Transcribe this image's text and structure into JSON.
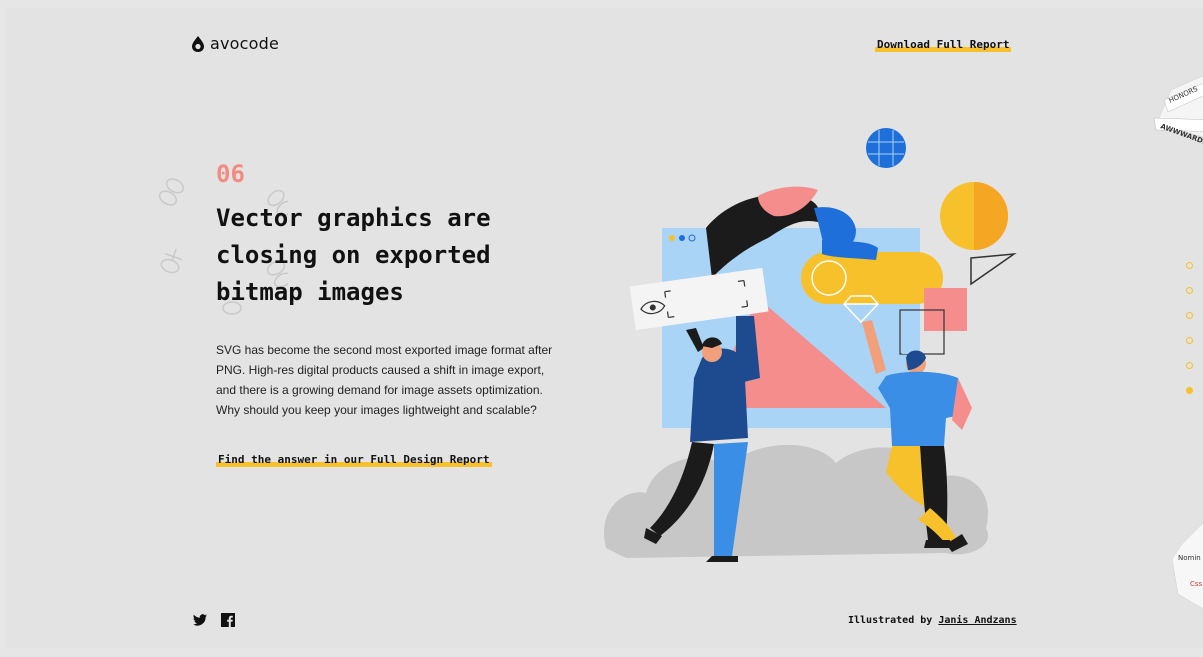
{
  "header": {
    "logo_text": "avocode",
    "download_label": "Download Full Report"
  },
  "section": {
    "number": "06",
    "headline_lines": [
      "Vector graphics are",
      "closing on exported",
      "bitmap images"
    ],
    "body_lines": [
      "SVG has become the second most exported image format after",
      "PNG. High-res digital products caused a shift in image export,",
      "and there is a growing demand for image assets optimization.",
      "Why should you keep your images lightweight and scalable?"
    ],
    "cta_label": "Find the answer in our Full Design Report"
  },
  "footer": {
    "credit_prefix": "Illustrated by",
    "credit_name": "Janis Andzans",
    "icons": [
      "twitter-icon",
      "facebook-icon"
    ]
  },
  "nav_dots": {
    "count": 6,
    "active_index": 5
  },
  "badges": {
    "top_line1": "HONORS",
    "top_line2": "AWWWARDS",
    "bottom_line1": "Nomin",
    "bottom_line2": "Css"
  },
  "colors": {
    "accent_yellow": "#f7c12b",
    "number_pink": "#f28b82",
    "background": "#e3e3e3"
  }
}
